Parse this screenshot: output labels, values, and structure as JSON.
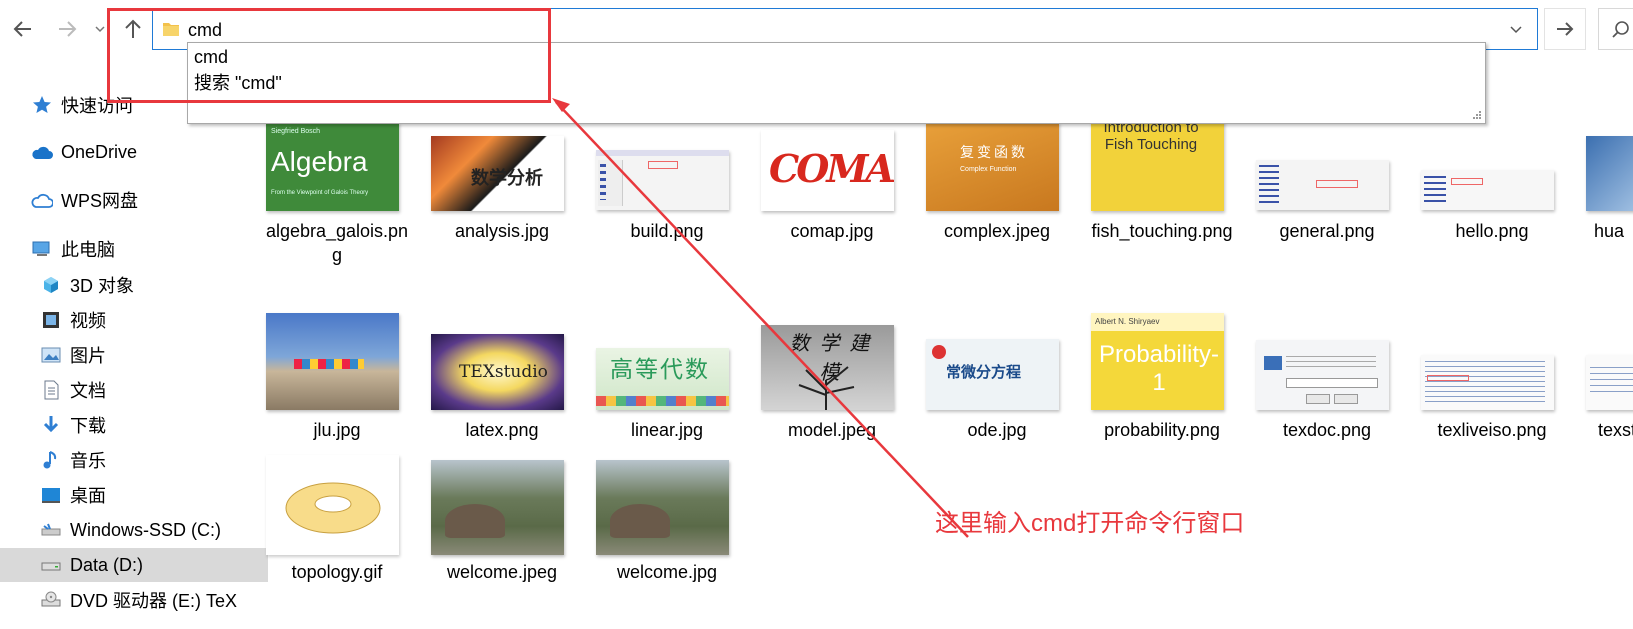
{
  "toolbar": {
    "address_value": "cmd"
  },
  "autocomplete": {
    "items": [
      "cmd",
      "搜索 \"cmd\""
    ]
  },
  "sidebar": {
    "items": [
      {
        "label": "快速访问",
        "icon": "star-icon"
      },
      {
        "label": "OneDrive",
        "icon": "cloud-icon"
      },
      {
        "label": "WPS网盘",
        "icon": "wps-cloud-icon"
      },
      {
        "label": "此电脑",
        "icon": "computer-icon"
      },
      {
        "label": "3D 对象",
        "icon": "cube-icon"
      },
      {
        "label": "视频",
        "icon": "video-icon"
      },
      {
        "label": "图片",
        "icon": "picture-icon"
      },
      {
        "label": "文档",
        "icon": "document-icon"
      },
      {
        "label": "下载",
        "icon": "download-icon"
      },
      {
        "label": "音乐",
        "icon": "music-icon"
      },
      {
        "label": "桌面",
        "icon": "desktop-icon"
      },
      {
        "label": "Windows-SSD (C:)",
        "icon": "drive-icon"
      },
      {
        "label": "Data (D:)",
        "icon": "drive-icon"
      },
      {
        "label": "DVD 驱动器 (E:) TeX",
        "icon": "dvd-icon"
      }
    ]
  },
  "files": {
    "row1": [
      {
        "name": "algebra_galois.png",
        "thumb_title": "Algebra",
        "thumb_sub": "From the Viewpoint of Galois Theory",
        "thumb_author": "Siegfried Bosch"
      },
      {
        "name": "analysis.jpg",
        "thumb_title": "数学分析"
      },
      {
        "name": "build.png"
      },
      {
        "name": "comap.jpg",
        "thumb_title": "COMAP"
      },
      {
        "name": "complex.jpeg",
        "thumb_title": "复变函数",
        "thumb_sub": "Complex Function"
      },
      {
        "name": "fish_touching.png",
        "thumb_title": "Introduction to Fish Touching"
      },
      {
        "name": "general.png"
      },
      {
        "name": "hello.png"
      },
      {
        "name": "hua"
      }
    ],
    "row2": [
      {
        "name": "jlu.jpg"
      },
      {
        "name": "latex.png",
        "thumb_title": "TEXstudio"
      },
      {
        "name": "linear.jpg",
        "thumb_title": "高等代数"
      },
      {
        "name": "model.jpeg",
        "thumb_title": "数学建模"
      },
      {
        "name": "ode.jpg",
        "thumb_title": "常微分方程"
      },
      {
        "name": "probability.png",
        "thumb_title": "Probability-1",
        "thumb_author": "Albert N. Shiryaev"
      },
      {
        "name": "texdoc.png"
      },
      {
        "name": "texliveiso.png"
      },
      {
        "name": "texst"
      }
    ],
    "row3": [
      {
        "name": "topology.gif"
      },
      {
        "name": "welcome.jpeg"
      },
      {
        "name": "welcome.jpg"
      }
    ]
  },
  "annotation": {
    "text": "这里输入cmd打开命令行窗口",
    "color": "#e8383d"
  },
  "colors": {
    "accent": "#1f7ad6",
    "selected": "#d9d9d9"
  }
}
